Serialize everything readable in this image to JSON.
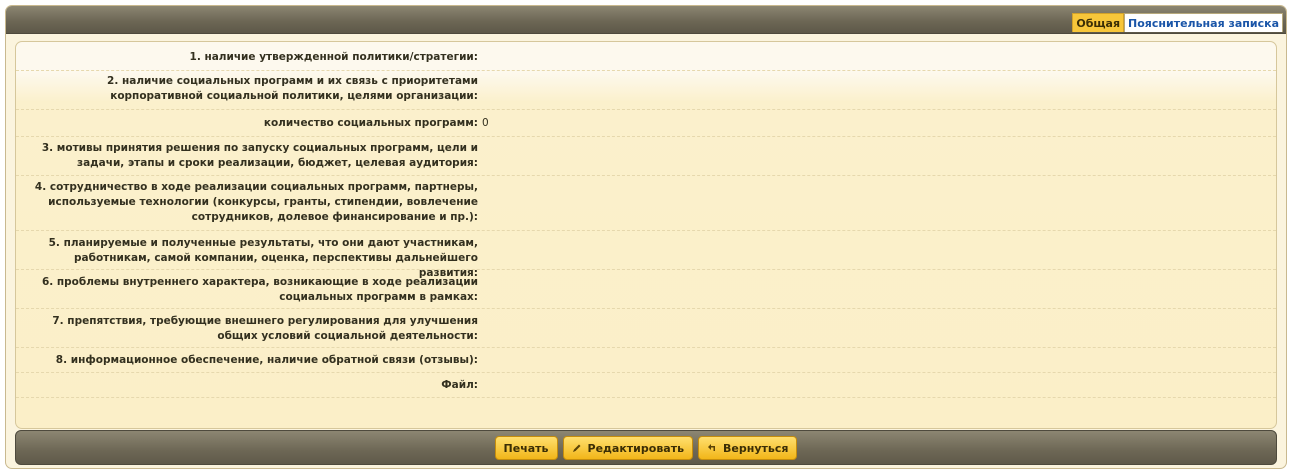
{
  "tabs": [
    {
      "label": "Общая",
      "active": true
    },
    {
      "label": "Пояснительная записка",
      "active": false
    }
  ],
  "rows": [
    {
      "label": "1. наличие утвержденной политики/стратегии:",
      "value": ""
    },
    {
      "label": "2. наличие социальных программ и их связь с приоритетами корпоративной социальной политики, целями организации:",
      "value": ""
    },
    {
      "label": "количество социальных программ:",
      "value": "0"
    },
    {
      "label": "3. мотивы принятия решения по запуску социальных программ, цели и задачи, этапы и сроки реализации, бюджет, целевая аудитория:",
      "value": ""
    },
    {
      "label": "4. сотрудничество в ходе реализации социальных программ, партнеры, используемые технологии (конкурсы, гранты, стипендии, вовлечение сотрудников, долевое финансирование и пр.):",
      "value": ""
    },
    {
      "label": "5. планируемые и полученные результаты, что они дают участникам, работникам, самой компании, оценка, перспективы дальнейшего развития:",
      "value": ""
    },
    {
      "label": "6. проблемы внутреннего характера, возникающие в ходе реализации социальных программ в рамках:",
      "value": ""
    },
    {
      "label": "7. препятствия, требующие внешнего регулирования для улучшения общих условий социальной деятельности:",
      "value": ""
    },
    {
      "label": "8. информационное обеспечение, наличие обратной связи (отзывы):",
      "value": ""
    },
    {
      "label": "Файл:",
      "value": ""
    }
  ],
  "buttons": {
    "print": "Печать",
    "edit": "Редактировать",
    "back": "Вернуться"
  },
  "icons": {
    "edit": "pencil-icon",
    "back": "return-arrow-icon"
  }
}
